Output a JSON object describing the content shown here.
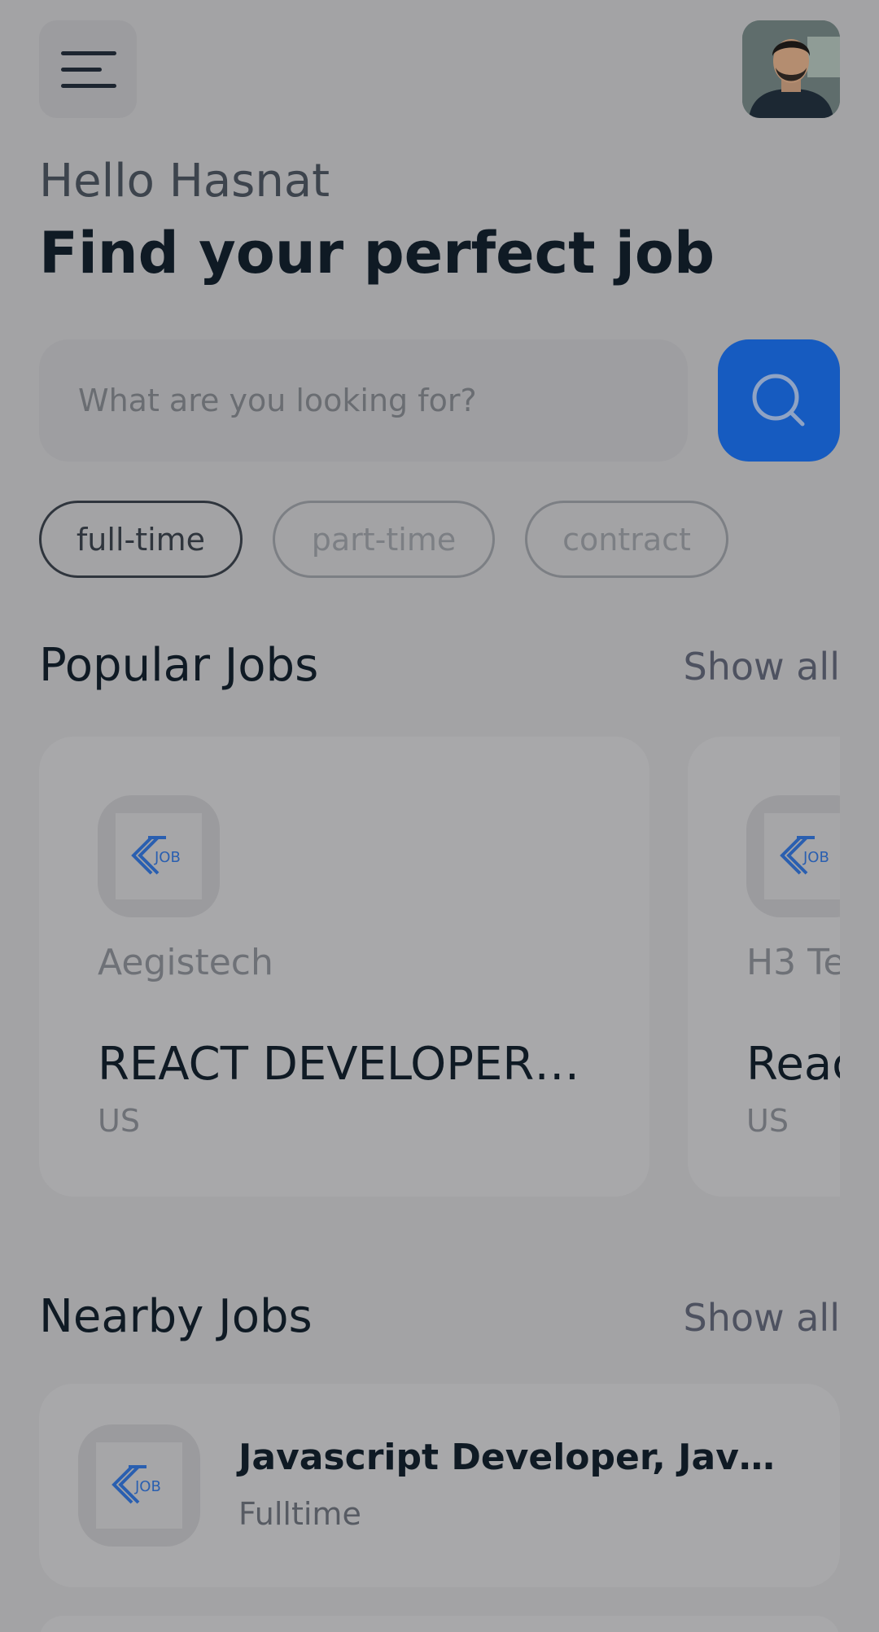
{
  "header": {
    "menu_icon": "menu-icon",
    "avatar": "profile-photo"
  },
  "greeting": "Hello Hasnat",
  "headline": "Find your perfect job",
  "search": {
    "placeholder": "What are you looking for?",
    "button_icon": "search-icon"
  },
  "filters": [
    {
      "label": "full-time",
      "active": true
    },
    {
      "label": "part-time",
      "active": false
    },
    {
      "label": "contract",
      "active": false
    }
  ],
  "popular": {
    "title": "Popular Jobs",
    "show_all": "Show all",
    "cards": [
      {
        "company": "Aegistech",
        "title": "REACT DEVELOPER…",
        "location": "US"
      },
      {
        "company": "H3 Te",
        "title": "Reac",
        "location": "US"
      }
    ]
  },
  "nearby": {
    "title": "Nearby Jobs",
    "show_all": "Show all",
    "items": [
      {
        "title": "Javascript Developer, Jav…",
        "type": "Fulltime"
      }
    ]
  },
  "logo_text": "JOB",
  "colors": {
    "accent": "#165bc0",
    "background": "#a3a3a5",
    "text_dark": "#0f1a24"
  }
}
